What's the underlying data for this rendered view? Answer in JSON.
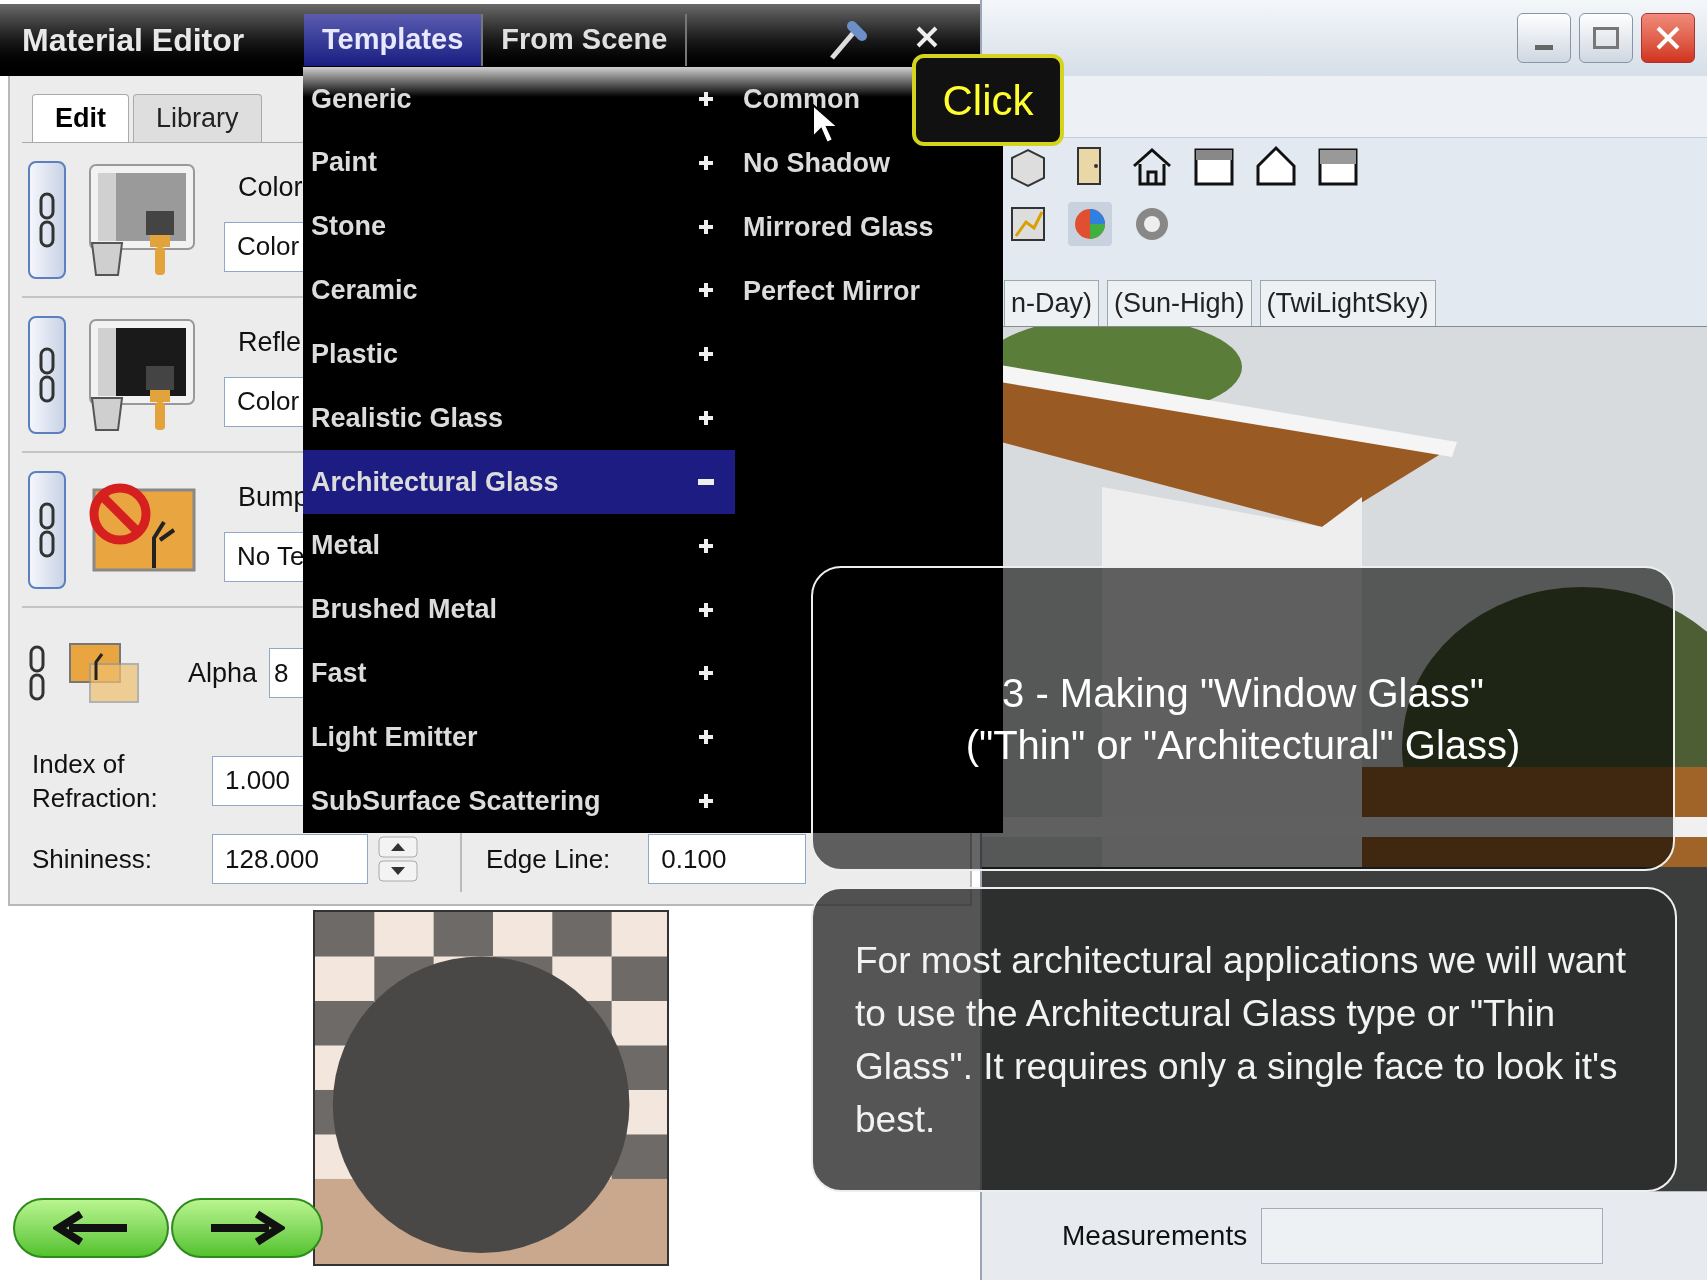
{
  "material_editor": {
    "title": "Material Editor",
    "menu_tabs": [
      {
        "label": "Templates",
        "selected": true
      },
      {
        "label": "From Scene",
        "selected": false
      }
    ],
    "tabs": [
      {
        "label": "Edit",
        "selected": true
      },
      {
        "label": "Library",
        "selected": false
      }
    ],
    "channels": [
      {
        "label": "Color",
        "field": "Color",
        "kind": "paint"
      },
      {
        "label": "Refle",
        "field": "Color",
        "kind": "dark-paint"
      },
      {
        "label": "Bump",
        "field": "No Te",
        "kind": "no-texture"
      }
    ],
    "alpha": {
      "label": "Alpha",
      "field": "8"
    },
    "index_of_refraction": {
      "label": "Index of Refraction:",
      "field": "1.000"
    },
    "shininess": {
      "label": "Shininess:",
      "field": "128.000"
    },
    "edge_line": {
      "label": "Edge Line:",
      "field": "0.100"
    }
  },
  "templates_menu": {
    "items": [
      {
        "label": "Generic",
        "selected": false,
        "expanded": false
      },
      {
        "label": "Paint",
        "selected": false,
        "expanded": false
      },
      {
        "label": "Stone",
        "selected": false,
        "expanded": false
      },
      {
        "label": "Ceramic",
        "selected": false,
        "expanded": false
      },
      {
        "label": "Plastic",
        "selected": false,
        "expanded": false
      },
      {
        "label": "Realistic Glass",
        "selected": false,
        "expanded": false
      },
      {
        "label": "Architectural Glass",
        "selected": true,
        "expanded": true
      },
      {
        "label": "Metal",
        "selected": false,
        "expanded": false
      },
      {
        "label": "Brushed Metal",
        "selected": false,
        "expanded": false
      },
      {
        "label": "Fast",
        "selected": false,
        "expanded": false
      },
      {
        "label": "Light Emitter",
        "selected": false,
        "expanded": false
      },
      {
        "label": "SubSurface Scattering",
        "selected": false,
        "expanded": false
      }
    ],
    "submenu": [
      "Common",
      "No Shadow",
      "Mirrored Glass",
      "Perfect Mirror"
    ]
  },
  "click_callout": {
    "text": "Click"
  },
  "sketchup": {
    "scene_tabs": [
      "n-Day)",
      "(Sun-High)",
      "(TwiLightSky)"
    ],
    "status_bar": {
      "label": "Measurements"
    }
  },
  "tutorial": {
    "title": [
      "3 - Making \"Window Glass\"",
      "(\"Thin\" or \"Architectural\" Glass)"
    ],
    "body": "For most architectural applications we will want to use the Architectural Glass type or \"Thin Glass\".  It requires only a single face to look it's best."
  }
}
